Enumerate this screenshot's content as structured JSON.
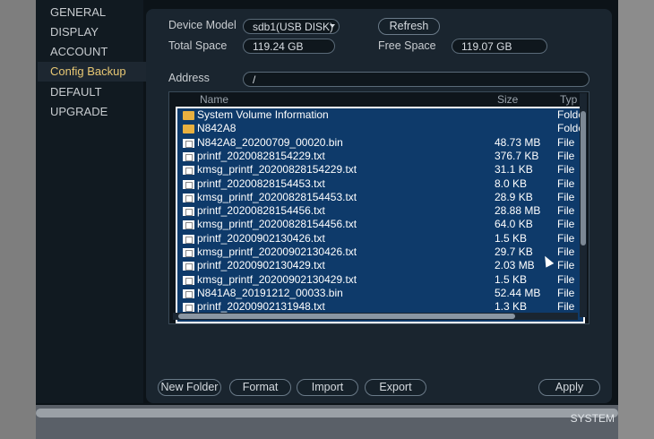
{
  "sidebar": {
    "items": [
      {
        "label": "GENERAL",
        "active": false
      },
      {
        "label": "DISPLAY",
        "active": false
      },
      {
        "label": "ACCOUNT",
        "active": false
      },
      {
        "label": "Config Backup",
        "active": true
      },
      {
        "label": "DEFAULT",
        "active": false
      },
      {
        "label": "UPGRADE",
        "active": false
      }
    ]
  },
  "device": {
    "model_label": "Device Model",
    "model_value": "sdb1(USB DISK)",
    "refresh_label": "Refresh",
    "total_label": "Total Space",
    "total_value": "119.24 GB",
    "free_label": "Free Space",
    "free_value": "119.07 GB",
    "address_label": "Address",
    "address_value": "/"
  },
  "table": {
    "columns": [
      "Name",
      "Size",
      "Typ"
    ],
    "rows": [
      {
        "name": "System Volume Information",
        "size": "",
        "type": "Folde",
        "icon": "folder-icon"
      },
      {
        "name": "N842A8",
        "size": "",
        "type": "Folde",
        "icon": "folder-icon"
      },
      {
        "name": "N842A8_20200709_00020.bin",
        "size": "48.73 MB",
        "type": "File",
        "icon": "file-icon"
      },
      {
        "name": "printf_20200828154229.txt",
        "size": "376.7 KB",
        "type": "File",
        "icon": "file-icon"
      },
      {
        "name": "kmsg_printf_20200828154229.txt",
        "size": "31.1 KB",
        "type": "File",
        "icon": "file-icon"
      },
      {
        "name": "printf_20200828154453.txt",
        "size": "8.0 KB",
        "type": "File",
        "icon": "file-icon"
      },
      {
        "name": "kmsg_printf_20200828154453.txt",
        "size": "28.9 KB",
        "type": "File",
        "icon": "file-icon"
      },
      {
        "name": "printf_20200828154456.txt",
        "size": "28.88 MB",
        "type": "File",
        "icon": "file-icon"
      },
      {
        "name": "kmsg_printf_20200828154456.txt",
        "size": "64.0 KB",
        "type": "File",
        "icon": "file-icon"
      },
      {
        "name": "printf_20200902130426.txt",
        "size": "1.5 KB",
        "type": "File",
        "icon": "file-icon"
      },
      {
        "name": "kmsg_printf_20200902130426.txt",
        "size": "29.7 KB",
        "type": "File",
        "icon": "file-icon"
      },
      {
        "name": "printf_20200902130429.txt",
        "size": "2.03 MB",
        "type": "File",
        "icon": "file-icon"
      },
      {
        "name": "kmsg_printf_20200902130429.txt",
        "size": "1.5 KB",
        "type": "File",
        "icon": "file-icon"
      },
      {
        "name": "N841A8_20191212_00033.bin",
        "size": "52.44 MB",
        "type": "File",
        "icon": "file-icon"
      },
      {
        "name": "printf_20200902131948.txt",
        "size": "1.3 KB",
        "type": "File",
        "icon": "file-icon"
      }
    ]
  },
  "actions": {
    "new_folder": "New Folder",
    "format": "Format",
    "import": "Import",
    "export": "Export",
    "apply": "Apply"
  },
  "bottom": {
    "system_label": "SYSTEM"
  },
  "colors": {
    "accent_active": "#e8c874",
    "selection": "#0e3a6a",
    "panel": "#1a252f"
  }
}
